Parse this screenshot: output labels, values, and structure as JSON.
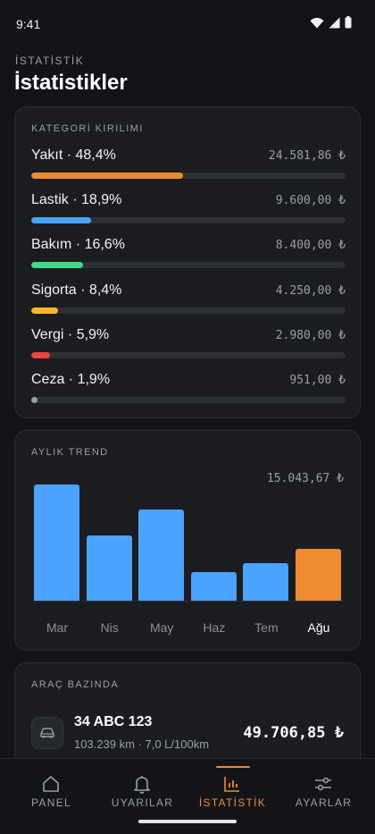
{
  "status": {
    "time": "9:41"
  },
  "header": {
    "eyebrow": "İSTATİSTİK",
    "title": "İstatistikler"
  },
  "category": {
    "title": "KATEGORİ KIRILIMI",
    "items": [
      {
        "label": "Yakıt · 48,4%",
        "amount": "24.581,86 ₺",
        "share": 0.484,
        "color": "#f08a33"
      },
      {
        "label": "Lastik · 18,9%",
        "amount": "9.600,00 ₺",
        "share": 0.189,
        "color": "#4aa3ff"
      },
      {
        "label": "Bakım · 16,6%",
        "amount": "8.400,00 ₺",
        "share": 0.166,
        "color": "#3ddc84"
      },
      {
        "label": "Sigorta · 8,4%",
        "amount": "4.250,00 ₺",
        "share": 0.084,
        "color": "#f7b731"
      },
      {
        "label": "Vergi · 5,9%",
        "amount": "2.980,00 ₺",
        "share": 0.059,
        "color": "#ef4444"
      },
      {
        "label": "Ceza · 1,9%",
        "amount": "951,00 ₺",
        "share": 0.019,
        "color": "#9aa0a6"
      }
    ]
  },
  "trend": {
    "title": "AYLIK TREND",
    "total": "15.043,67 ₺"
  },
  "chart_data": {
    "type": "bar",
    "categories": [
      "Mar",
      "Nis",
      "May",
      "Haz",
      "Tem",
      "Ağu"
    ],
    "values": [
      15043.67,
      8500,
      11800,
      3700,
      4900,
      6700
    ],
    "highlight_index": 5,
    "colors": {
      "default": "#4aa3ff",
      "highlight": "#f08a33"
    },
    "ylim": [
      0,
      15043.67
    ]
  },
  "vehicles": {
    "title": "ARAÇ BAZINDA",
    "items": [
      {
        "plate": "34 ABC 123",
        "details": "103.239 km · 7,0 L/100km",
        "total": "49.706,85 ₺"
      }
    ]
  },
  "nav": {
    "items": [
      {
        "label": "PANEL",
        "icon": "home-icon"
      },
      {
        "label": "UYARILAR",
        "icon": "bell-icon"
      },
      {
        "label": "İSTATİSTİK",
        "icon": "chart-icon"
      },
      {
        "label": "AYARLAR",
        "icon": "sliders-icon"
      }
    ],
    "active_index": 2
  }
}
